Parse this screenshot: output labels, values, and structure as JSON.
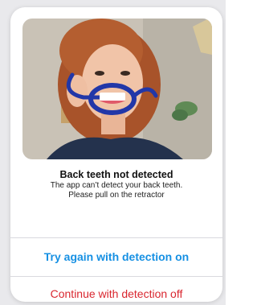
{
  "dialog": {
    "title": "Back teeth not detected",
    "message_line1": "The app can’t detect your back teeth.",
    "message_line2": "Please pull on the retractor",
    "image_icon": "retractor-example-photo"
  },
  "actions": {
    "primary_label": "Try again with detection on",
    "secondary_label": "Continue with detection off"
  },
  "colors": {
    "primary": "#1690e3",
    "destructive": "#d9262f"
  }
}
